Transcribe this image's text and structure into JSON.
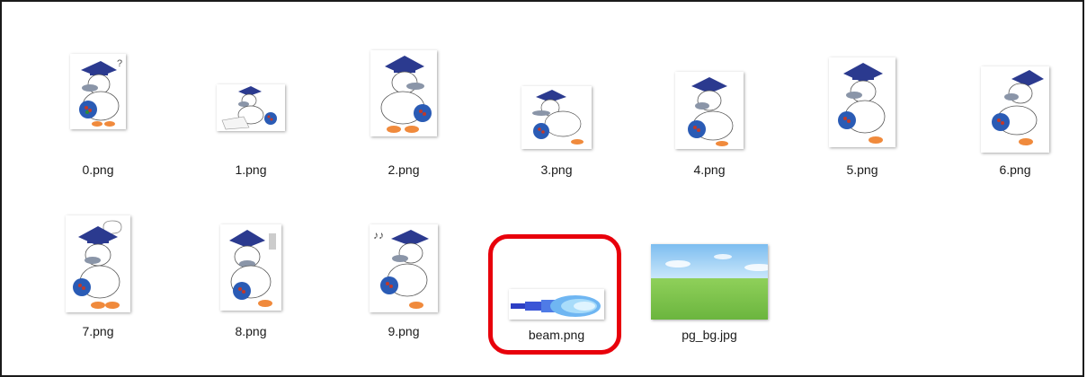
{
  "files": [
    {
      "name": "0.png"
    },
    {
      "name": "1.png"
    },
    {
      "name": "2.png"
    },
    {
      "name": "3.png"
    },
    {
      "name": "4.png"
    },
    {
      "name": "5.png"
    },
    {
      "name": "6.png"
    },
    {
      "name": "7.png"
    },
    {
      "name": "8.png"
    },
    {
      "name": "9.png"
    },
    {
      "name": "beam.png"
    },
    {
      "name": "pg_bg.jpg"
    }
  ],
  "colors": {
    "highlight": "#e8000b",
    "mascot_cap": "#2b3a8f",
    "mascot_body": "#ffffff",
    "mascot_beak": "#8a95a8",
    "mascot_feet": "#f08a3c",
    "mascot_bag": "#2a5bb5",
    "beam_core": "#dff4ff",
    "beam_outer": "#2d3fc4",
    "sky": "#8cc8f0",
    "grass": "#7cc24a"
  }
}
